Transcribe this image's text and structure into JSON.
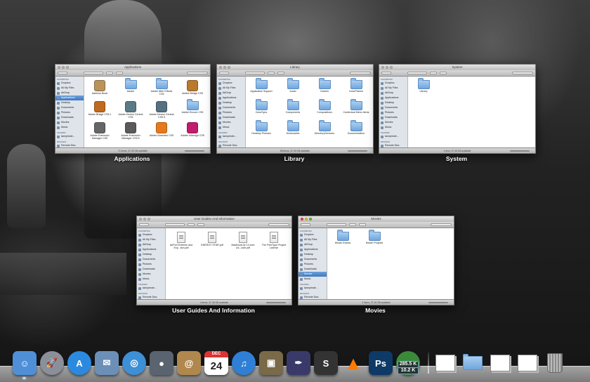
{
  "windows": [
    {
      "id": "applications",
      "title": "Applications",
      "caption": "Applications",
      "status": "71 items, 37.45 GB available",
      "sidebar": [
        {
          "type": "header",
          "label": "FAVORITES"
        },
        {
          "label": "Dropbox"
        },
        {
          "label": "All My Files"
        },
        {
          "label": "AirDrop"
        },
        {
          "label": "Applications",
          "selected": true
        },
        {
          "label": "Desktop"
        },
        {
          "label": "Documents"
        },
        {
          "label": "Pictures"
        },
        {
          "label": "Downloads"
        },
        {
          "label": "Movies"
        },
        {
          "label": "Music"
        },
        {
          "type": "header",
          "label": "SHARED"
        },
        {
          "label": "tannpimde..."
        },
        {
          "type": "header",
          "label": "DEVICES"
        },
        {
          "label": "Remote Disc"
        }
      ],
      "items": [
        {
          "label": "Address Book",
          "icon": "app",
          "color": "#b8935a"
        },
        {
          "label": "Adobe",
          "icon": "folder"
        },
        {
          "label": "Adobe After Effects CS5",
          "icon": "folder"
        },
        {
          "label": "Adobe Bridge CS5",
          "icon": "app",
          "color": "#b87a2c"
        },
        {
          "label": "Adobe Bridge CS5.1",
          "icon": "app",
          "color": "#c06a1f"
        },
        {
          "label": "Adobe Device Central CS5",
          "icon": "app",
          "color": "#5a7a85"
        },
        {
          "label": "Adobe Device Central CS5.5",
          "icon": "app",
          "color": "#557080"
        },
        {
          "label": "Adobe Encore CS5",
          "icon": "folder"
        },
        {
          "label": "Adobe Extension Manager CS5",
          "icon": "app",
          "color": "#666"
        },
        {
          "label": "Adobe Extension Manager CS5.5",
          "icon": "app",
          "color": "#5a5a5a"
        },
        {
          "label": "Adobe Illustrator CS5",
          "icon": "app",
          "color": "#e8791a"
        },
        {
          "label": "Adobe InDesign CS5",
          "icon": "app",
          "color": "#c11c6d"
        }
      ]
    },
    {
      "id": "library",
      "title": "Library",
      "caption": "Library",
      "status": "58 items, 37.45 GB available",
      "sidebar": [
        {
          "type": "header",
          "label": "FAVORITES"
        },
        {
          "label": "Dropbox"
        },
        {
          "label": "All My Files"
        },
        {
          "label": "AirDrop"
        },
        {
          "label": "Applications"
        },
        {
          "label": "Desktop"
        },
        {
          "label": "Documents"
        },
        {
          "label": "Pictures"
        },
        {
          "label": "Downloads"
        },
        {
          "label": "Movies"
        },
        {
          "label": "Music"
        },
        {
          "type": "header",
          "label": "SHARED"
        },
        {
          "label": "tannpimde..."
        },
        {
          "type": "header",
          "label": "DEVICES"
        },
        {
          "label": "Remote Disc"
        }
      ],
      "items": [
        {
          "label": "Application Support",
          "icon": "folder"
        },
        {
          "label": "Audio",
          "icon": "folder"
        },
        {
          "label": "Caches",
          "icon": "folder"
        },
        {
          "label": "ColorPickers",
          "icon": "folder"
        },
        {
          "label": "ColorSync",
          "icon": "folder"
        },
        {
          "label": "Components",
          "icon": "folder"
        },
        {
          "label": "Compositions",
          "icon": "folder"
        },
        {
          "label": "Contextual Menu Items",
          "icon": "folder"
        },
        {
          "label": "Desktop Pictures",
          "icon": "folder"
        },
        {
          "label": "Dictionaries",
          "icon": "folder"
        },
        {
          "label": "DirectoryServices",
          "icon": "folder"
        },
        {
          "label": "Documentation",
          "icon": "folder"
        }
      ]
    },
    {
      "id": "system",
      "title": "System",
      "caption": "System",
      "status": "1 item, 37.45 GB available",
      "sidebar": [
        {
          "type": "header",
          "label": "FAVORITES"
        },
        {
          "label": "Dropbox"
        },
        {
          "label": "All My Files"
        },
        {
          "label": "AirDrop"
        },
        {
          "label": "Applications"
        },
        {
          "label": "Desktop"
        },
        {
          "label": "Documents"
        },
        {
          "label": "Pictures"
        },
        {
          "label": "Downloads"
        },
        {
          "label": "Movies"
        },
        {
          "label": "Music"
        },
        {
          "type": "header",
          "label": "SHARED"
        },
        {
          "label": "tannpimde..."
        },
        {
          "type": "header",
          "label": "DEVICES"
        },
        {
          "label": "Remote Disc"
        }
      ],
      "items": [
        {
          "label": "Library",
          "icon": "folder"
        }
      ]
    },
    {
      "id": "user-guides",
      "title": "User Guides And Information",
      "caption": "User Guides And Information",
      "status": "4 items, 37.45 GB available",
      "sidebar": [
        {
          "type": "header",
          "label": "FAVORITES"
        },
        {
          "label": "Dropbox"
        },
        {
          "label": "All My Files"
        },
        {
          "label": "AirDrop"
        },
        {
          "label": "Applications"
        },
        {
          "label": "Desktop"
        },
        {
          "label": "Documents"
        },
        {
          "label": "Pictures"
        },
        {
          "label": "Downloads"
        },
        {
          "label": "Movies"
        },
        {
          "label": "Music"
        },
        {
          "type": "header",
          "label": "SHARED"
        },
        {
          "label": "tannpimde..."
        },
        {
          "type": "header",
          "label": "DEVICES"
        },
        {
          "label": "Remote Disc"
        }
      ],
      "items": [
        {
          "label": "AirPort Extreme and Exp...tion.pdf",
          "icon": "doc"
        },
        {
          "label": "ENERGY STAR.pdf",
          "icon": "doc"
        },
        {
          "label": "MacBook Air 13-inch Us...uide.pdf",
          "icon": "doc"
        },
        {
          "label": "The FreeType Project License",
          "icon": "doc"
        }
      ]
    },
    {
      "id": "movies",
      "title": "Movies",
      "caption": "Movies",
      "status": "2 items, 37.45 GB available",
      "active": true,
      "sidebar": [
        {
          "type": "header",
          "label": "FAVORITES"
        },
        {
          "label": "Dropbox"
        },
        {
          "label": "All My Files"
        },
        {
          "label": "AirDrop"
        },
        {
          "label": "Applications"
        },
        {
          "label": "Desktop"
        },
        {
          "label": "Documents"
        },
        {
          "label": "Pictures"
        },
        {
          "label": "Downloads"
        },
        {
          "label": "Movies",
          "selected": true
        },
        {
          "label": "Music"
        },
        {
          "type": "header",
          "label": "SHARED"
        },
        {
          "label": "tannpimde..."
        },
        {
          "type": "header",
          "label": "DEVICES"
        },
        {
          "label": "Remote Disc"
        }
      ],
      "items": [
        {
          "label": "iMovie Events",
          "icon": "folder"
        },
        {
          "label": "iMovie Projects",
          "icon": "folder"
        }
      ]
    }
  ],
  "dock": {
    "items": [
      {
        "name": "finder",
        "icon": "finder-icon",
        "color": "#4f8fd8",
        "glyph": "☺",
        "running": true
      },
      {
        "name": "launchpad",
        "icon": "rocket-icon",
        "color": "#8a8f99",
        "glyph": "🚀",
        "round": true
      },
      {
        "name": "app-store",
        "icon": "app-store-icon",
        "color": "#2b8ae0",
        "glyph": "A",
        "round": true
      },
      {
        "name": "mail",
        "icon": "stamp-icon",
        "color": "#6c8fb8",
        "glyph": "✉"
      },
      {
        "name": "safari",
        "icon": "compass-icon",
        "color": "#3d8fd6",
        "glyph": "◎",
        "round": true
      },
      {
        "name": "facetime",
        "icon": "camera-icon",
        "color": "#5a6470",
        "glyph": "●"
      },
      {
        "name": "address-book",
        "icon": "address-book-icon",
        "color": "#b0884d",
        "glyph": "@"
      },
      {
        "name": "ical",
        "icon": "calendar-icon",
        "color": "#ffffff",
        "glyph": "24",
        "glyph_color": "#222",
        "month": "DEC"
      },
      {
        "name": "itunes",
        "icon": "music-note-icon",
        "color": "#2f7fd6",
        "glyph": "♫",
        "round": true
      },
      {
        "name": "iphoto",
        "icon": "photo-icon",
        "color": "#7a6a4a",
        "glyph": "▣"
      },
      {
        "name": "quill",
        "icon": "quill-icon",
        "color": "#3a3a6a",
        "glyph": "✒"
      },
      {
        "name": "scrivener",
        "icon": "scrivener-icon",
        "color": "#333333",
        "glyph": "S"
      },
      {
        "name": "vlc",
        "icon": "traffic-cone-icon",
        "color": "#ff7b00",
        "glyph": "▲",
        "transparent": true
      },
      {
        "name": "photoshop",
        "icon": "photoshop-icon",
        "color": "#0d3a66",
        "glyph": "Ps"
      },
      {
        "name": "utorrent",
        "icon": "utorrent-icon",
        "color": "#3a8a3a",
        "glyph": "µ",
        "round": true,
        "badge_up": "285.5 K",
        "badge_down": "10.2 K"
      }
    ],
    "stacks": [
      {
        "name": "document-stack",
        "icon": "document-stack-icon",
        "color": "#e8e8e8"
      },
      {
        "name": "folder-stack",
        "icon": "folder-stack-icon",
        "color": "#8ab8e6"
      },
      {
        "name": "screenshot-stack-1",
        "icon": "screenshot-icon",
        "color": "#dcdcdc"
      },
      {
        "name": "screenshot-stack-2",
        "icon": "screenshot-icon",
        "color": "#d0d0d0"
      },
      {
        "name": "trash",
        "icon": "trash-icon",
        "color": "#9aa0a8"
      }
    ]
  }
}
